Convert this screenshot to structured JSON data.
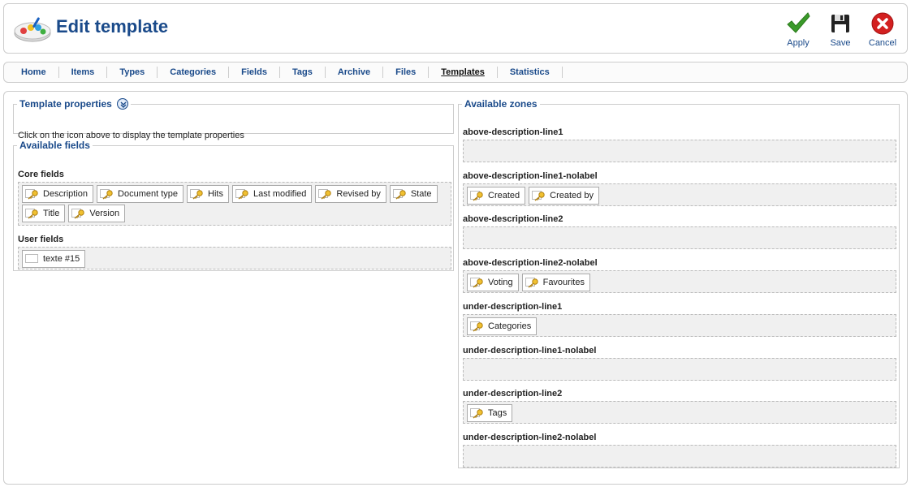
{
  "header": {
    "title": "Edit template",
    "toolbar": {
      "apply_label": "Apply",
      "save_label": "Save",
      "cancel_label": "Cancel"
    }
  },
  "nav": {
    "items": [
      "Home",
      "Items",
      "Types",
      "Categories",
      "Fields",
      "Tags",
      "Archive",
      "Files",
      "Templates",
      "Statistics"
    ],
    "active": "Templates"
  },
  "template_properties": {
    "legend": "Template properties",
    "text": "Click on the icon above to display the template properties"
  },
  "available_fields": {
    "legend": "Available fields",
    "core_label": "Core fields",
    "core_fields": [
      "Description",
      "Document type",
      "Hits",
      "Last modified",
      "Revised by",
      "State",
      "Title",
      "Version"
    ],
    "user_label": "User fields",
    "user_fields": [
      "texte #15"
    ]
  },
  "zones": {
    "legend": "Available zones",
    "list": [
      {
        "name": "above-description-line1",
        "fields": []
      },
      {
        "name": "above-description-line1-nolabel",
        "fields": [
          "Created",
          "Created by"
        ]
      },
      {
        "name": "above-description-line2",
        "fields": []
      },
      {
        "name": "above-description-line2-nolabel",
        "fields": [
          "Voting",
          "Favourites"
        ]
      },
      {
        "name": "under-description-line1",
        "fields": [
          "Categories"
        ]
      },
      {
        "name": "under-description-line1-nolabel",
        "fields": []
      },
      {
        "name": "under-description-line2",
        "fields": [
          "Tags"
        ]
      },
      {
        "name": "under-description-line2-nolabel",
        "fields": []
      }
    ]
  },
  "colors": {
    "accent": "#1a4a8a",
    "apply": "#3a9a2a",
    "cancel": "#d32020",
    "dropzone_bg": "#f0f0f0"
  }
}
